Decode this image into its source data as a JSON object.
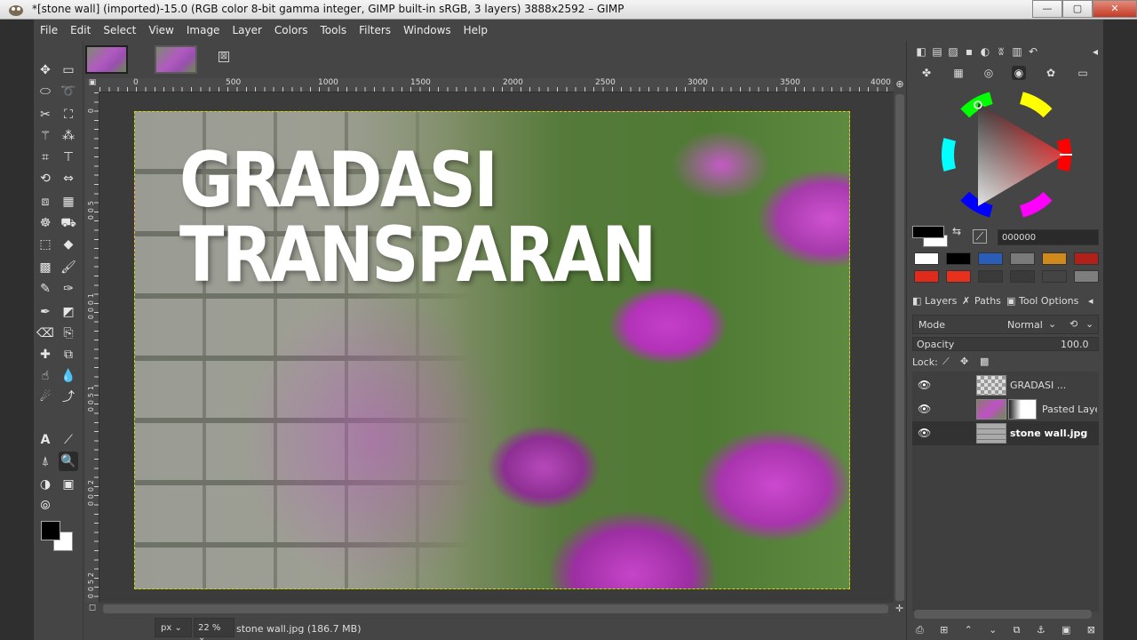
{
  "window": {
    "title": "*[stone wall] (imported)-15.0 (RGB color 8-bit gamma integer, GIMP built-in sRGB, 3 layers) 3888x2592 – GIMP",
    "min_label": "—",
    "max_label": "▢",
    "close_label": "✕"
  },
  "menu": [
    "File",
    "Edit",
    "Select",
    "View",
    "Image",
    "Layer",
    "Colors",
    "Tools",
    "Filters",
    "Windows",
    "Help"
  ],
  "image_tabs": {
    "close_glyph": "⊠"
  },
  "ruler": {
    "h_labels": [
      "0",
      "500",
      "1000",
      "1500",
      "2000",
      "2500",
      "3000",
      "3500",
      "4000"
    ],
    "v_labels": [
      "0",
      "5",
      "0",
      "0",
      "1",
      "0",
      "0",
      "0",
      "1",
      "5",
      "0",
      "0",
      "2",
      "0",
      "0",
      "0",
      "2",
      "5",
      "0",
      "0"
    ]
  },
  "canvas": {
    "line1": "GRADASI",
    "line2": "TRANSPARAN"
  },
  "status": {
    "unit": "px",
    "zoom": "22 %",
    "filename": "stone wall.jpg (186.7 MB)",
    "chevron": "⌄"
  },
  "color_panel": {
    "hex": "000000",
    "palette": [
      "#ffffff",
      "#000000",
      "#2a5db8",
      "#7a7a7a",
      "#d08a1c",
      "#b2201a",
      "#e02a1c",
      "#e8301e",
      "#3a3a3a",
      "#3a3a3a",
      "#444444",
      "#7e7e7e"
    ]
  },
  "tabs": {
    "layers": "Layers",
    "paths": "Paths",
    "tool_options": "Tool Options"
  },
  "layer_panel": {
    "mode_label": "Mode",
    "mode_value": "Normal",
    "opacity_label": "Opacity",
    "opacity_value": "100.0",
    "lock_label": "Lock:",
    "layers": [
      {
        "name": "GRADASI ...",
        "selected": false
      },
      {
        "name": "Pasted Laye",
        "selected": false
      },
      {
        "name": "stone wall.jpg",
        "selected": true
      }
    ]
  },
  "colors": {
    "accent_fg": "#000000",
    "accent_bg": "#ffffff",
    "selection_marching": "#d6d600"
  }
}
